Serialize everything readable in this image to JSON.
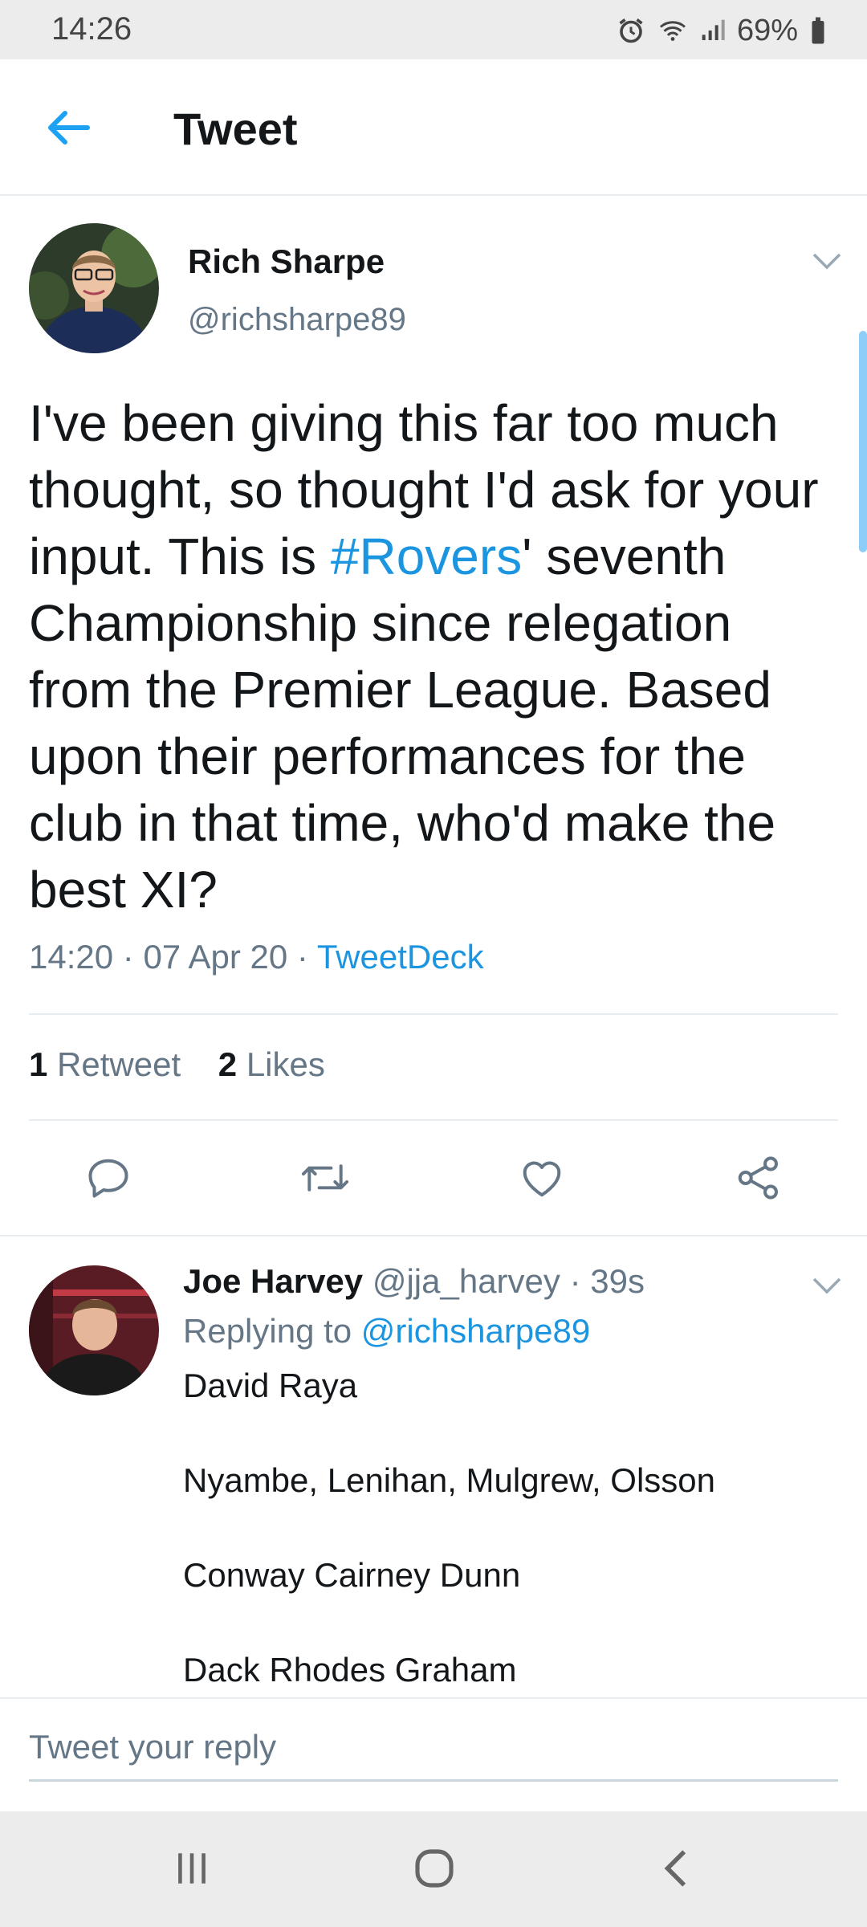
{
  "status_bar": {
    "time": "14:26",
    "battery": "69%"
  },
  "header": {
    "title": "Tweet"
  },
  "tweet": {
    "author_name": "Rich Sharpe",
    "author_handle": "@richsharpe89",
    "text_before": "I've been giving this far too much thought, so thought I'd ask for your input. This is ",
    "hashtag": "#Rovers",
    "text_after": "' seventh Championship since relegation from the Premier League. Based upon their performances for the club in that time, who'd make the best XI?",
    "time": "14:20",
    "date": "07 Apr 20",
    "source": "TweetDeck",
    "retweets_count": "1",
    "retweets_label": "Retweet",
    "likes_count": "2",
    "likes_label": "Likes"
  },
  "reply": {
    "author_name": "Joe Harvey",
    "author_handle": "@jja_harvey",
    "age": "39s",
    "replying_label": "Replying to",
    "replying_handle": "@richsharpe89",
    "lines": [
      "David Raya",
      "Nyambe, Lenihan, Mulgrew, Olsson",
      "Conway Cairney Dunn",
      "Dack Rhodes Graham"
    ]
  },
  "composer": {
    "placeholder": "Tweet your reply"
  },
  "colors": {
    "accent": "#1b95e0",
    "secondary_text": "#657786",
    "divider": "#e6ecf0"
  },
  "icons": [
    "back-arrow-icon",
    "chevron-down-icon",
    "reply-icon",
    "retweet-icon",
    "like-icon",
    "share-icon",
    "alarm-icon",
    "wifi-icon",
    "signal-icon",
    "battery-icon",
    "recents-icon",
    "home-icon",
    "nav-back-icon"
  ]
}
